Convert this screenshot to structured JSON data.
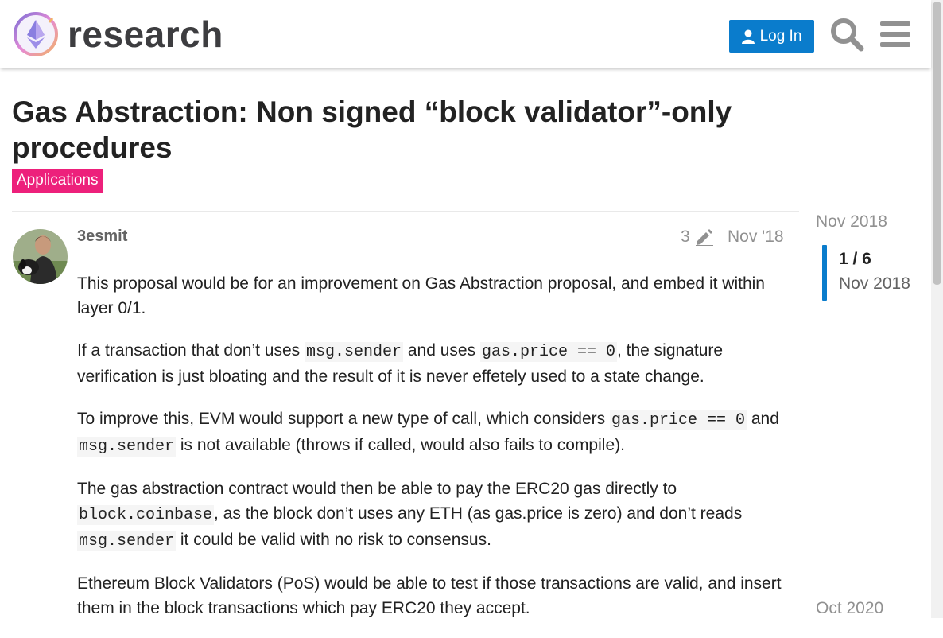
{
  "header": {
    "logo_text": "research",
    "login_label": "Log In",
    "icons": {
      "logo": "ethereum-research-logo",
      "search": "search-icon",
      "menu": "hamburger-menu-icon",
      "user": "user-icon"
    },
    "accent_color": "#0a7ccc"
  },
  "topic": {
    "title": "Gas Abstraction: Non signed “block validator”-only procedures",
    "category": "Applications",
    "category_color": "#ed207b"
  },
  "post": {
    "username": "3esmit",
    "edit_count": "3",
    "date": "Nov '18",
    "paragraphs": {
      "p1": "This proposal would be for an improvement on Gas Abstraction proposal, and embed it within layer 0/1.",
      "p2a": "If a transaction that don’t uses ",
      "p2b": "msg.sender",
      "p2c": " and uses ",
      "p2d": "gas.price == 0",
      "p2e": ", the signature verification is just bloating and the result of it is never effetely used to a state change.",
      "p3a": "To improve this, EVM would support a new type of call, which considers ",
      "p3b": "gas.price == 0",
      "p3c": " and ",
      "p3d": "msg.sender",
      "p3e": " is not available (throws if called, would also fails to compile).",
      "p4a": "The gas abstraction contract would then be able to pay the ERC20 gas directly to ",
      "p4b": "block.coinbase",
      "p4c": ", as the block don’t uses any ETH (as gas.price is zero) and don’t reads ",
      "p4d": "msg.sender",
      "p4e": " it could be valid with no risk to consensus.",
      "p5": "Ethereum Block Validators (PoS) would be able to test if those transactions are valid, and insert them in the block transactions which pay ERC20 they accept."
    }
  },
  "timeline": {
    "start": "Nov 2018",
    "progress": "1 / 6",
    "current": "Nov 2018",
    "end": "Oct 2020"
  }
}
